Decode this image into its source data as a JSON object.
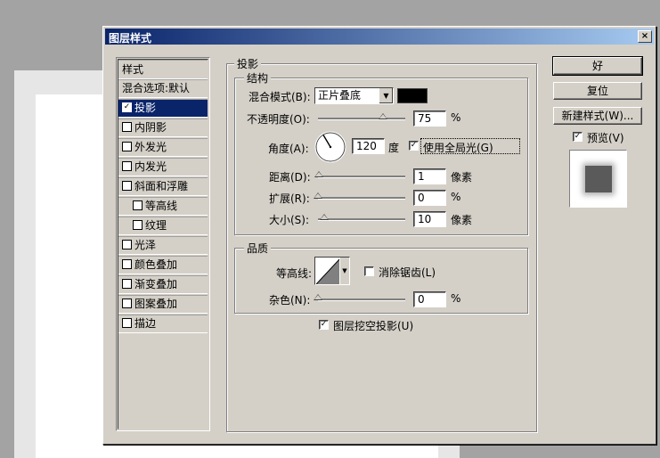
{
  "dialog": {
    "title": "图层样式",
    "close_glyph": "×"
  },
  "sidebar": {
    "header": "样式",
    "blend_options": "混合选项:默认",
    "items": [
      {
        "label": "投影",
        "checked": true,
        "check_glyph": "✓"
      },
      {
        "label": "内阴影",
        "checked": false
      },
      {
        "label": "外发光",
        "checked": false
      },
      {
        "label": "内发光",
        "checked": false
      },
      {
        "label": "斜面和浮雕",
        "checked": false
      },
      {
        "label": "等高线",
        "checked": false
      },
      {
        "label": "纹理",
        "checked": false
      },
      {
        "label": "光泽",
        "checked": false
      },
      {
        "label": "颜色叠加",
        "checked": false
      },
      {
        "label": "渐变叠加",
        "checked": false
      },
      {
        "label": "图案叠加",
        "checked": false
      },
      {
        "label": "描边",
        "checked": false
      }
    ]
  },
  "drop_shadow": {
    "section_title": "投影",
    "structure": {
      "title": "结构",
      "blend_mode_label": "混合模式(B):",
      "blend_mode_value": "正片叠底",
      "shadow_color": "#000000",
      "opacity_label": "不透明度(O):",
      "opacity_value": "75",
      "opacity_unit": "%",
      "opacity_fraction": 0.75,
      "angle_label": "角度(A):",
      "angle_value": "120",
      "angle_unit": "度",
      "global_light_label": "使用全局光(G)",
      "global_light_checked": true,
      "distance_label": "距离(D):",
      "distance_value": "1",
      "distance_unit": "像素",
      "spread_label": "扩展(R):",
      "spread_value": "0",
      "spread_unit": "%",
      "size_label": "大小(S):",
      "size_value": "10",
      "size_unit": "像素"
    },
    "quality": {
      "title": "品质",
      "contour_label": "等高线:",
      "antialias_label": "消除锯齿(L)",
      "antialias_checked": false,
      "noise_label": "杂色(N):",
      "noise_value": "0",
      "noise_unit": "%"
    },
    "knockout_label": "图层挖空投影(U)",
    "knockout_checked": true
  },
  "buttons": {
    "ok": "好",
    "reset": "复位",
    "new_style": "新建样式(W)...",
    "preview_label": "预览(V)",
    "preview_checked": true
  },
  "check_glyph": "✓",
  "dropdown_glyph": "▼",
  "colors": {
    "titlebar_start": "#0a246a",
    "titlebar_end": "#a6caf0",
    "dialog_bg": "#d4d0c8",
    "selection": "#0a246a"
  }
}
